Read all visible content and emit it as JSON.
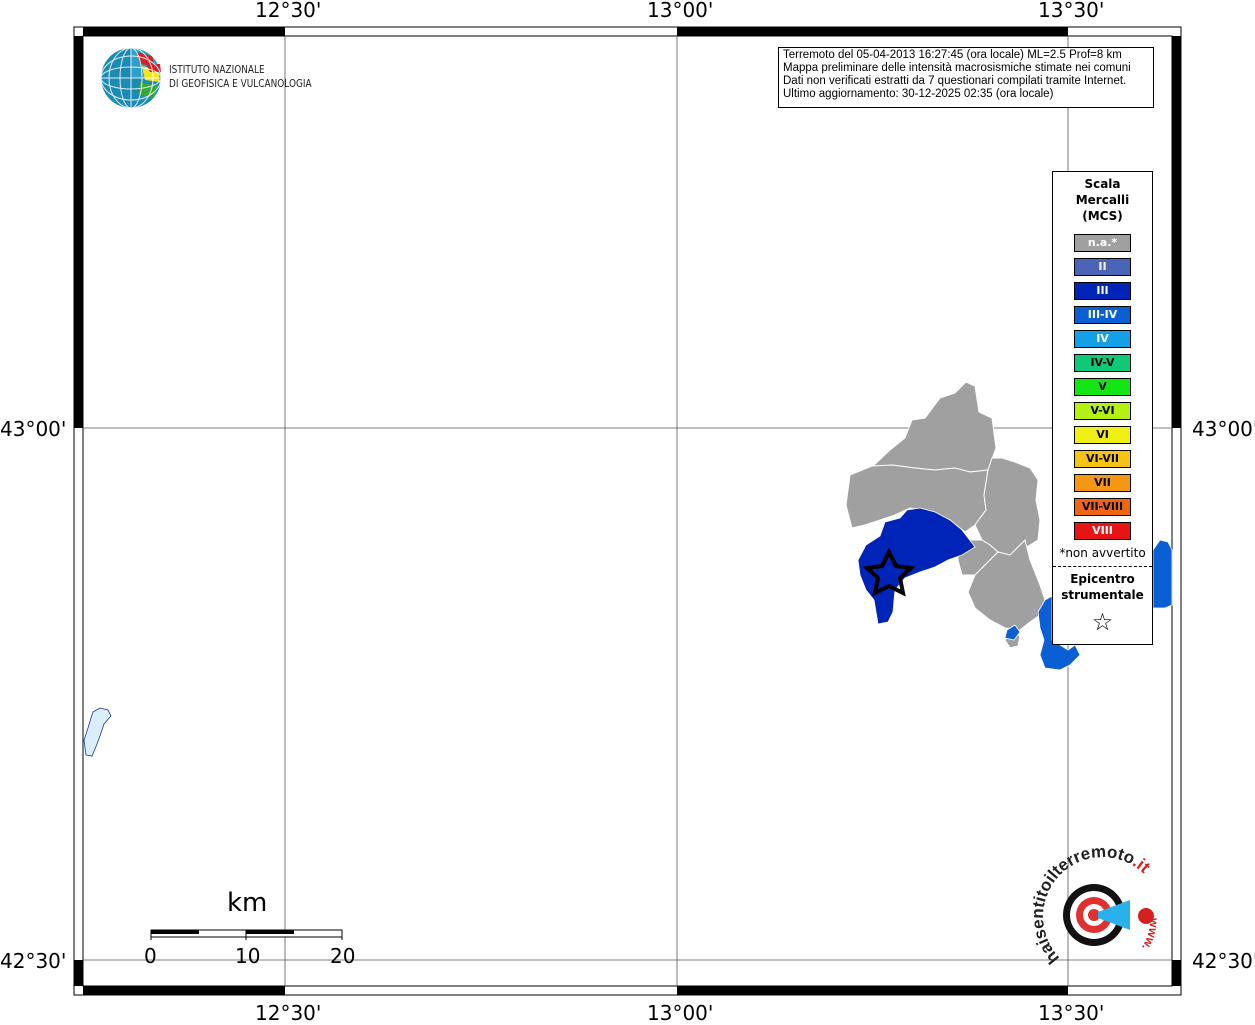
{
  "map": {
    "info": {
      "line1": "Terremoto del 05-04-2013 16:27:45 (ora locale) ML=2.5 Prof=8 km",
      "line2": "Mappa preliminare delle intensità macrosismiche stimate nei comuni",
      "line3": "Dati non verificati estratti da 7 questionari compilati tramite Internet.",
      "line4": "Ultimo aggiornamento: 30-12-2025 02:35 (ora locale)"
    },
    "lon_labels": [
      "12°30'",
      "13°00'",
      "13°30'"
    ],
    "lat_labels": [
      "43°00'",
      "42°30'"
    ],
    "logo": {
      "line1": "ISTITUTO NAZIONALE",
      "line2": "DI GEOFISICA E VULCANOLOGIA"
    },
    "scale_bar": {
      "unit": "km",
      "ticks": [
        "0",
        "10",
        "20"
      ]
    },
    "legend": {
      "title_lines": [
        "Scala",
        "Mercalli",
        "(MCS)"
      ],
      "items": [
        {
          "label": "n.a.*",
          "color": "#a0a0a0",
          "text_color": "#ffffff"
        },
        {
          "label": "II",
          "color": "#4a65b5",
          "text_color": "#ffffff"
        },
        {
          "label": "III",
          "color": "#0023b8",
          "text_color": "#ffffff"
        },
        {
          "label": "III-IV",
          "color": "#0a5fd4",
          "text_color": "#ffffff"
        },
        {
          "label": "IV",
          "color": "#14a0e6",
          "text_color": "#ffffff"
        },
        {
          "label": "IV-V",
          "color": "#0fc878",
          "text_color": "#000000"
        },
        {
          "label": "V",
          "color": "#14e614",
          "text_color": "#000000"
        },
        {
          "label": "V-VI",
          "color": "#b4f014",
          "text_color": "#000000"
        },
        {
          "label": "VI",
          "color": "#f0f014",
          "text_color": "#000000"
        },
        {
          "label": "VI-VII",
          "color": "#f5c314",
          "text_color": "#000000"
        },
        {
          "label": "VII",
          "color": "#f59614",
          "text_color": "#000000"
        },
        {
          "label": "VII-VIII",
          "color": "#f06414",
          "text_color": "#000000"
        },
        {
          "label": "VIII",
          "color": "#e61414",
          "text_color": "#ffffff"
        }
      ],
      "note": "*non avvertito",
      "epicenter_lines": [
        "Epicentro",
        "strumentale"
      ],
      "epicenter_symbol": "☆"
    },
    "hsi_logo": {
      "text_dark": "haisentito",
      "text_mid": "ilterremoto",
      "text_red": ".it",
      "url_text": "www."
    },
    "colors": {
      "not_felt": "#a0a0a0",
      "III": "#0023b8",
      "III_IV": "#0a5fd4",
      "lake": "#dbeefb"
    }
  }
}
